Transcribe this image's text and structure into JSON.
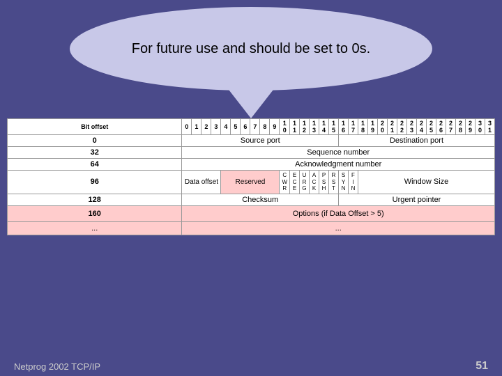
{
  "bubble": {
    "text": "For future use and should be set to 0s."
  },
  "table": {
    "bit_offset_label": "Bit offset",
    "bit_numbers_1": [
      "0",
      "1",
      "2",
      "3",
      "4",
      "5",
      "6",
      "7",
      "8",
      "9",
      "1",
      "0",
      "1",
      "1",
      "1",
      "2",
      "1",
      "3",
      "1",
      "4",
      "1",
      "5"
    ],
    "bit_numbers_2": [
      "1",
      "6",
      "1",
      "7",
      "1",
      "8",
      "1",
      "9",
      "2",
      "0",
      "2",
      "1",
      "2",
      "2",
      "2",
      "3",
      "2",
      "4",
      "2",
      "5",
      "2",
      "6",
      "2",
      "7",
      "2",
      "8",
      "2",
      "9",
      "3",
      "0",
      "3",
      "1"
    ],
    "rows": [
      {
        "offset": "0",
        "cols": [
          {
            "text": "Source port",
            "span": 16
          },
          {
            "text": "Destination port",
            "span": 16
          }
        ]
      },
      {
        "offset": "32",
        "cols": [
          {
            "text": "Sequence number",
            "span": 32
          }
        ]
      },
      {
        "offset": "64",
        "cols": [
          {
            "text": "Acknowledgment number",
            "span": 32
          }
        ]
      },
      {
        "offset": "96",
        "cols": [
          {
            "text": "Data offset",
            "span": 4
          },
          {
            "text": "Reserved",
            "span": 6,
            "highlight": true
          },
          {
            "text": "C\nW\nR",
            "span": 1,
            "flags": true
          },
          {
            "text": "E\nC\nE",
            "span": 1,
            "flags": true
          },
          {
            "text": "U\nR\nG",
            "span": 1,
            "flags": true
          },
          {
            "text": "A\nC\nK",
            "span": 1,
            "flags": true
          },
          {
            "text": "P\nS\nH",
            "span": 1,
            "flags": true
          },
          {
            "text": "R\nS\nT",
            "span": 1,
            "flags": true
          },
          {
            "text": "S\nY\nN",
            "span": 1,
            "flags": true
          },
          {
            "text": "F\nI\nN",
            "span": 1,
            "flags": true
          },
          {
            "text": "Window Size",
            "span": 16
          }
        ]
      },
      {
        "offset": "128",
        "cols": [
          {
            "text": "Checksum",
            "span": 16
          },
          {
            "text": "Urgent pointer",
            "span": 16
          }
        ]
      },
      {
        "offset": "160",
        "cols": [
          {
            "text": "Options (if Data Offset > 5)",
            "span": 32,
            "highlight": true
          }
        ]
      },
      {
        "offset": "...",
        "cols": [
          {
            "text": "...",
            "span": 32,
            "highlight": true
          }
        ]
      }
    ]
  },
  "footer": {
    "label": "Netprog 2002  TCP/IP",
    "page": "51"
  }
}
